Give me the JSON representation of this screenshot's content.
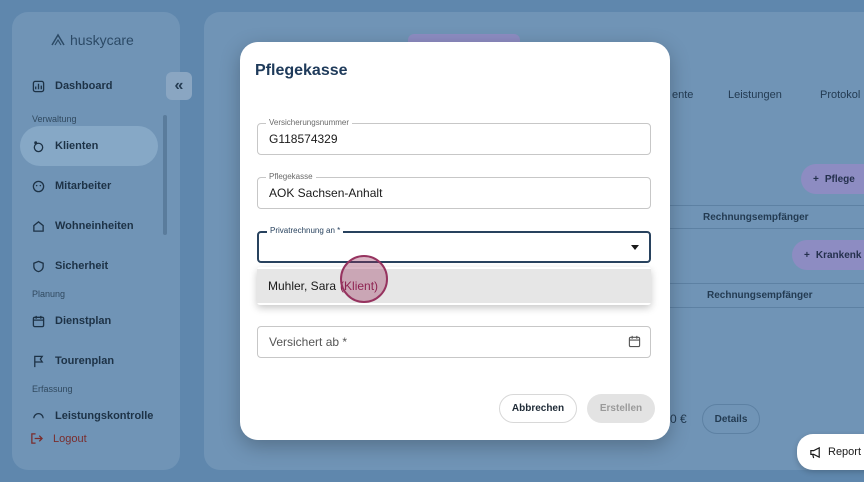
{
  "app": {
    "logo_text": "huskycare"
  },
  "sidebar": {
    "collapse_label": "«",
    "sections": {
      "verwaltung": "Verwaltung",
      "planung": "Planung",
      "erfassung": "Erfassung"
    },
    "items": [
      {
        "label": "Dashboard",
        "icon": "dashboard-icon"
      },
      {
        "label": "Klienten",
        "icon": "clients-icon",
        "active": true
      },
      {
        "label": "Mitarbeiter",
        "icon": "employees-icon"
      },
      {
        "label": "Wohneinheiten",
        "icon": "housing-icon"
      },
      {
        "label": "Sicherheit",
        "icon": "security-icon"
      },
      {
        "label": "Dienstplan",
        "icon": "calendar-icon"
      },
      {
        "label": "Tourenplan",
        "icon": "flag-icon"
      },
      {
        "label": "Leistungskontrolle",
        "icon": "gauge-icon"
      }
    ],
    "logout_label": "Logout"
  },
  "background": {
    "tabs": [
      "ente",
      "Leistungen",
      "Protokol"
    ],
    "pflege_button": "Pflege",
    "kranken_button": "Krankenk",
    "table_header_1": "Rechnungsempfänger",
    "table_header_2": "Rechnungsempfänger",
    "amount": "0 €",
    "details_label": "Details"
  },
  "modal": {
    "title": "Pflegekasse",
    "fields": {
      "versicherungsnummer": {
        "label": "Versicherungsnummer",
        "value": "G118574329"
      },
      "pflegekasse": {
        "label": "Pflegekasse",
        "value": "AOK Sachsen-Anhalt"
      },
      "privatrechnung": {
        "label": "Privatrechnung an *",
        "value": ""
      },
      "versichert_ab": {
        "placeholder": "Versichert ab *"
      }
    },
    "dropdown_options": [
      {
        "name": "Muhler, Sara",
        "role": "(Klient)"
      }
    ],
    "cancel_label": "Abbrechen",
    "create_label": "Erstellen"
  },
  "report_button": {
    "label": "Report a"
  },
  "colors": {
    "backdrop": "#5f87ad",
    "accent": "#1e3a5a",
    "option_role": "#8a1e4e",
    "click_marker": "#96335f"
  }
}
